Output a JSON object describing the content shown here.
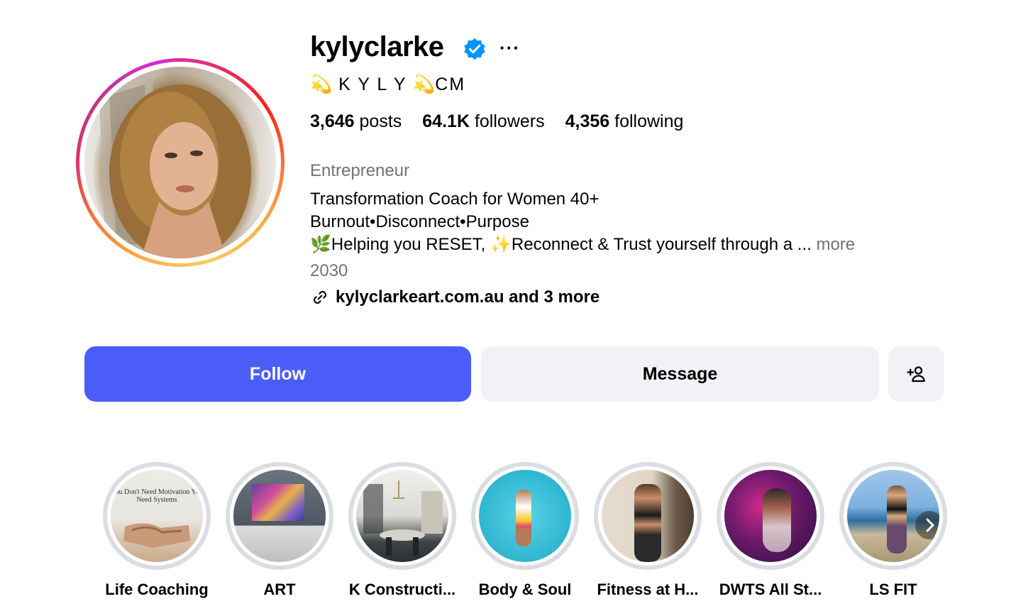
{
  "profile": {
    "username": "kylyclarke",
    "more_label": "···",
    "display_name": "K Y L Y",
    "display_name_suffix": "CM",
    "display_emoji": "💫",
    "stats": {
      "posts_count": "3,646",
      "posts_label": "posts",
      "followers_count": "64.1K",
      "followers_label": "followers",
      "following_count": "4,356",
      "following_label": "following"
    },
    "category": "Entrepreneur",
    "bio": {
      "line1": "Transformation Coach for Women 40+",
      "line2": "Burnout•Disconnect•Purpose",
      "line3_emoji1": "🌿",
      "line3_a": "Helping you RESET, ",
      "line3_emoji2": "✨",
      "line3_b": "Reconnect & Trust yourself through a ... ",
      "more": "more",
      "line4": "2030"
    },
    "link_text": "kylyclarkeart.com.au and 3 more"
  },
  "actions": {
    "follow_label": "Follow",
    "message_label": "Message",
    "add_user_icon": "person-add-icon"
  },
  "highlights": [
    {
      "label": "Life Coaching",
      "cover_text": "You Don't Need Motivation You Need Systems"
    },
    {
      "label": "ART"
    },
    {
      "label": "K Constructi..."
    },
    {
      "label": "Body & Soul"
    },
    {
      "label": "Fitness at H..."
    },
    {
      "label": "DWTS All St..."
    },
    {
      "label": "LS FIT"
    }
  ],
  "colors": {
    "follow_bg": "#4a5df9",
    "secondary_bg": "#f0f2f5",
    "muted_text": "#737373",
    "verified_blue": "#0095f6"
  }
}
